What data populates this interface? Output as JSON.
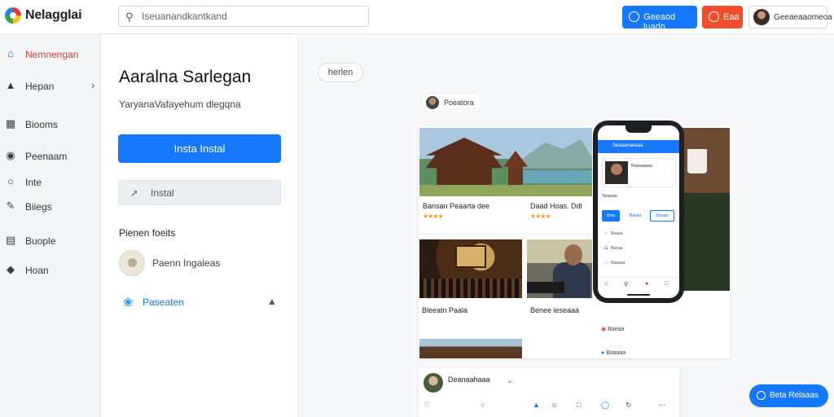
{
  "app": {
    "name": "Nelagglai"
  },
  "search": {
    "placeholder": "Iseuanandkantkand"
  },
  "header": {
    "primary_button": "Geeaod luado",
    "alert_button": "Eaa",
    "user_name": "Geeaeaaomeoa"
  },
  "sidebar": {
    "items": [
      {
        "label": "Nemnengan",
        "icon": "home-icon",
        "active": true
      },
      {
        "label": "Hepan",
        "icon": "folder-icon",
        "has_chevron": true
      },
      {
        "label": "Biooms",
        "icon": "grid-icon"
      },
      {
        "label": "Peenaam",
        "icon": "camera-icon"
      },
      {
        "label": "Inte",
        "icon": "info-icon"
      },
      {
        "label": "Biiegs",
        "icon": "pen-icon"
      },
      {
        "label": "Buople",
        "icon": "chart-icon"
      },
      {
        "label": "Hoan",
        "icon": "tag-icon"
      }
    ]
  },
  "panel": {
    "title": "Aaralna Sarlegan",
    "subtitle": "YaryanaVafayehum dlegqna",
    "primary_action": "Insta Instal",
    "secondary_action": "Instal",
    "section_title": "Pienen foeits",
    "contact_name": "Paenn Ingaleas",
    "link_label": "Paseaten"
  },
  "main": {
    "chip": "herlen",
    "card_author": "Poeatora",
    "items": [
      {
        "title": "Bansan Peaarta dee",
        "rating": "★★★★"
      },
      {
        "title": "Daad Hoas. Ddl",
        "rating": "★★★★"
      },
      {
        "title": "Bleeatn Paala",
        "rating": "★★★★"
      },
      {
        "title": "Benee ieseaaa",
        "rating": ""
      }
    ],
    "post_author": "Deanaahaaa"
  },
  "phone": {
    "header": "Seaaanaeaaa",
    "card_title": "Roaoaeaaa",
    "label": "Teoaooe",
    "actions": [
      "Boia",
      "Baeaa",
      "Baaaa"
    ],
    "rows": [
      "Baaaa",
      "Baeaa",
      "Baaaaa"
    ],
    "side_rows": [
      "Baeaa",
      "Baaaaa"
    ]
  },
  "fab": {
    "label": "Beta Relaaas"
  }
}
